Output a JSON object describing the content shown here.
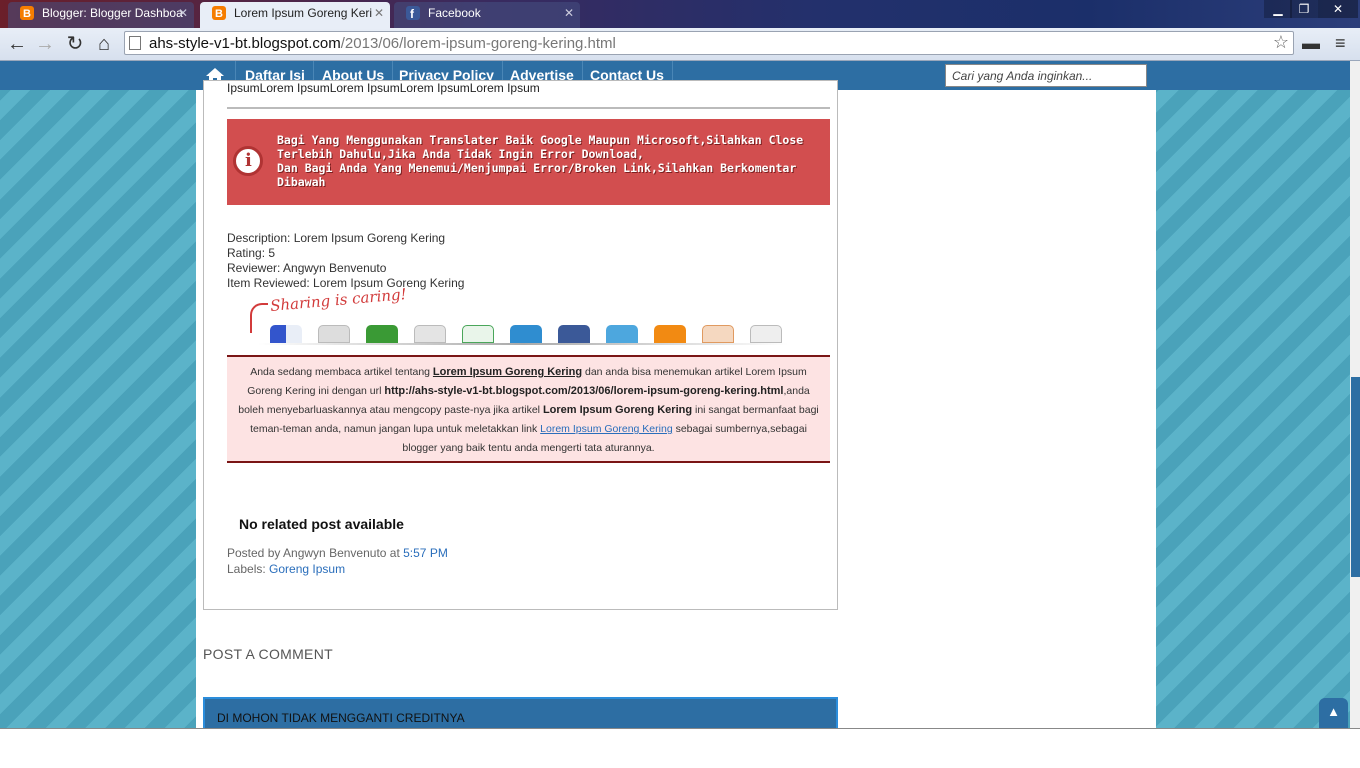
{
  "browser": {
    "tabs": [
      {
        "label": "Blogger: Blogger Dashboa",
        "favicon": "blogger-icon",
        "active": false
      },
      {
        "label": "Lorem Ipsum Goreng Keri",
        "favicon": "blogger-icon",
        "active": true
      },
      {
        "label": "Facebook",
        "favicon": "facebook-icon",
        "active": false
      }
    ],
    "url_domain": "ahs-style-v1-bt.blogspot.com",
    "url_path": "/2013/06/lorem-ipsum-goreng-kering.html"
  },
  "nav": {
    "items": [
      "Daftar Isi",
      "About Us",
      "Privacy Policy",
      "Advertise",
      "Contact Us"
    ],
    "search_placeholder": "Cari yang Anda inginkan..."
  },
  "post": {
    "lorem_top": "IpsumLorem IpsumLorem IpsumLorem IpsumLorem Ipsum",
    "alert_lines": [
      "Bagi Yang Menggunakan Translater Baik Google Maupun Microsoft,Silahkan Close",
      "Terlebih Dahulu,Jika Anda Tidak Ingin Error Download,",
      "Dan Bagi Anda Yang Menemui/Menjumpai Error/Broken Link,Silahkan Berkomentar",
      "Dibawah"
    ],
    "meta": {
      "description": "Description: Lorem Ipsum Goreng Kering",
      "rating": "Rating: 5",
      "reviewer": "Reviewer: Angwyn Benvenuto",
      "item_reviewed": "Item Reviewed: Lorem Ipsum Goreng Kering"
    },
    "sharing_caption": "Sharing is caring!",
    "notice": {
      "p1": "Anda sedang membaca artikel tentang ",
      "title": "Lorem Ipsum Goreng Kering",
      "p2": " dan anda bisa menemukan artikel Lorem Ipsum Goreng Kering ini dengan url ",
      "url": "http://ahs-style-v1-bt.blogspot.com/2013/06/lorem-ipsum-goreng-kering.html",
      "p3": ",anda boleh menyebarluaskannya atau mengcopy paste-nya jika artikel ",
      "title_bold": "Lorem Ipsum Goreng Kering",
      "p4": " ini sangat bermanfaat bagi teman-teman anda, namun jangan lupa untuk meletakkan link ",
      "link_text": "Lorem Ipsum Goreng Kering",
      "p5": " sebagai sumbernya,sebagai blogger yang baik tentu anda mengerti tata aturannya."
    },
    "related": "No related post available",
    "posted_by": "Posted by Angwyn Benvenuto at ",
    "posted_time": "5:57 PM",
    "labels_prefix": "Labels: ",
    "label": "Goreng Ipsum"
  },
  "comments": {
    "heading": "POST A COMMENT",
    "credit_box": "DI MOHON TIDAK MENGGANTI CREDITNYA"
  },
  "colors": {
    "accent": "#2d6ea3",
    "alert": "#d24e4f",
    "notice_bg": "#fde3e3",
    "link": "#2a6ebb"
  }
}
